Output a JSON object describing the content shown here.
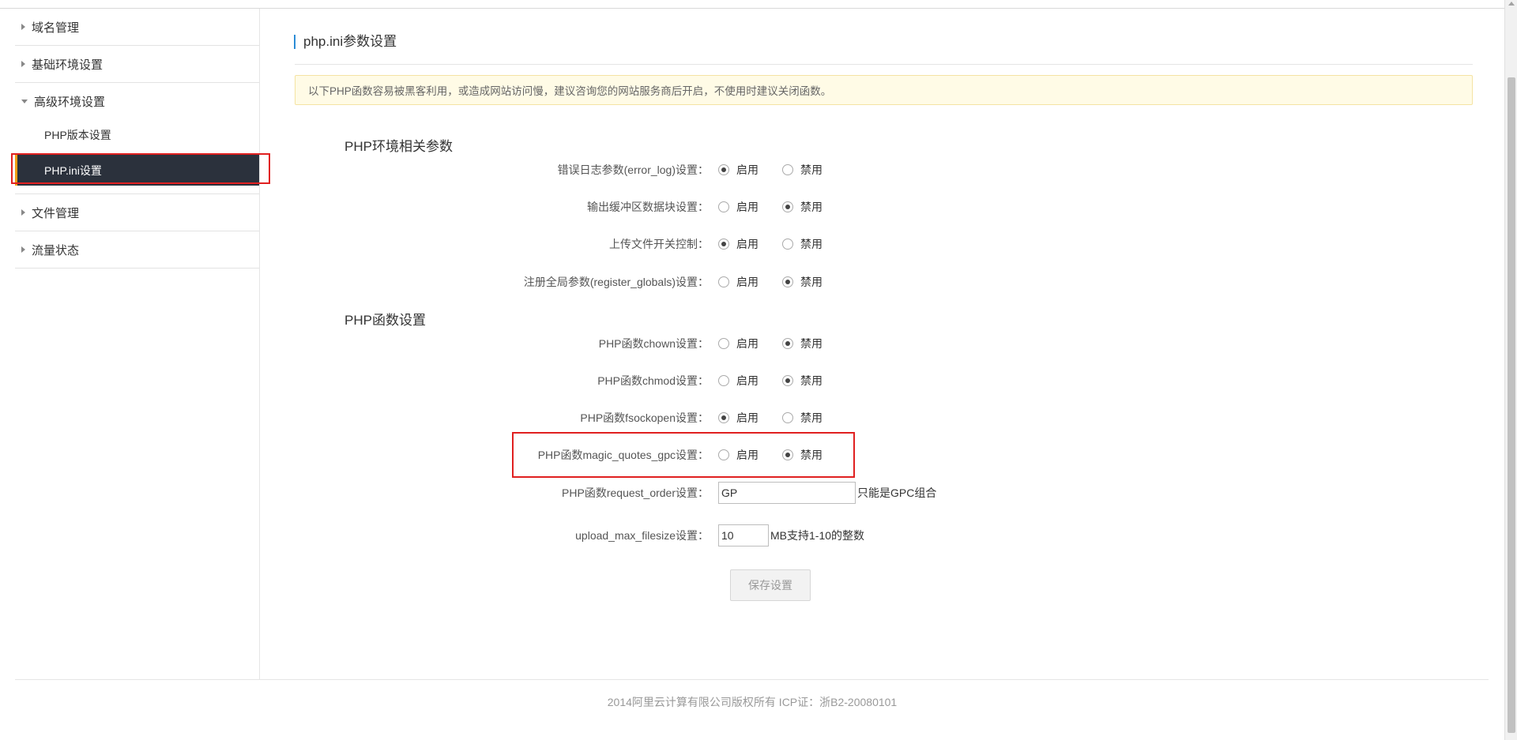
{
  "sidebar": {
    "groups": [
      {
        "label": "域名管理"
      },
      {
        "label": "基础环境设置"
      },
      {
        "label": "高级环境设置",
        "items": [
          {
            "label": "PHP版本设置"
          },
          {
            "label": "PHP.ini设置"
          }
        ]
      },
      {
        "label": "文件管理"
      },
      {
        "label": "流量状态"
      }
    ]
  },
  "main": {
    "title": "php.ini参数设置",
    "notice": "以下PHP函数容易被黑客利用，或造成网站访问慢，建议咨询您的网站服务商后开启，不使用时建议关闭函数。",
    "sections": [
      {
        "title": "PHP环境相关参数",
        "rows": [
          {
            "label": "错误日志参数(error_log)设置：",
            "value": "on"
          },
          {
            "label": "输出缓冲区数据块设置：",
            "value": "off"
          },
          {
            "label": "上传文件开关控制：",
            "value": "on"
          },
          {
            "label": "注册全局参数(register_globals)设置：",
            "value": "off"
          }
        ]
      },
      {
        "title": "PHP函数设置",
        "rows": [
          {
            "label": "PHP函数chown设置：",
            "value": "off"
          },
          {
            "label": "PHP函数chmod设置：",
            "value": "off"
          },
          {
            "label": "PHP函数fsockopen设置：",
            "value": "on"
          },
          {
            "label": "PHP函数magic_quotes_gpc设置：",
            "value": "off"
          }
        ]
      }
    ],
    "radio_on_label": "启用",
    "radio_off_label": "禁用",
    "request_order": {
      "label": "PHP函数request_order设置：",
      "value": "GP",
      "hint": "只能是GPC组合"
    },
    "upload_max": {
      "label": "upload_max_filesize设置：",
      "value": "10",
      "hint": "MB支持1-10的整数"
    },
    "save_label": "保存设置"
  },
  "footer": "2014阿里云计算有限公司版权所有 ICP证：浙B2-20080101"
}
